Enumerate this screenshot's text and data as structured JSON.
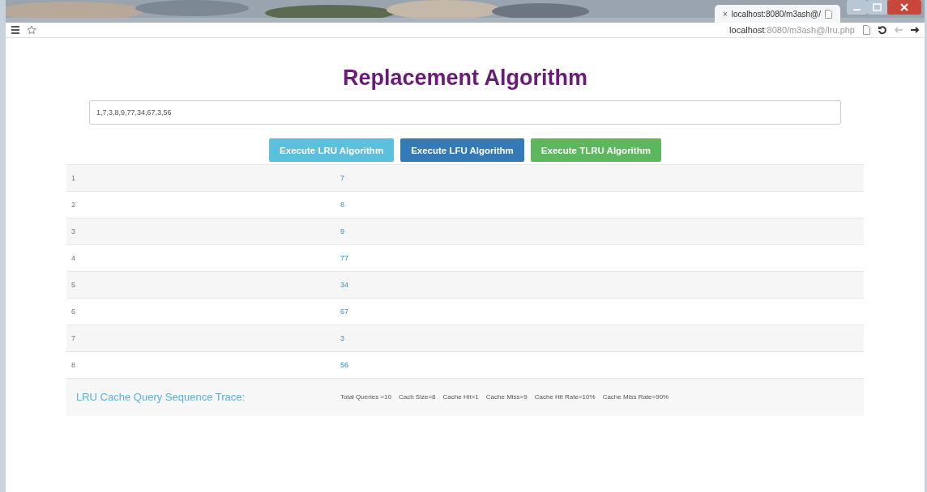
{
  "browser": {
    "tab_title": "localhost:8080/m3ash@/",
    "tab_close": "×",
    "url_host": "localhost",
    "url_path": ":8080/m3ash@/lru.php"
  },
  "page": {
    "title": "Replacement Algorithm",
    "input": {
      "value": "1,7,3,8,9,77,34,67,3,56"
    },
    "buttons": [
      {
        "label": "Execute LRU Algorithm",
        "color": "#5bc0de"
      },
      {
        "label": "Execute LFU Algorithm",
        "color": "#337ab7"
      },
      {
        "label": "Execute TLRU Algorithm",
        "color": "#5cb85c"
      }
    ],
    "rows": [
      {
        "index": "1",
        "value": "7"
      },
      {
        "index": "2",
        "value": "8"
      },
      {
        "index": "3",
        "value": "9"
      },
      {
        "index": "4",
        "value": "77"
      },
      {
        "index": "5",
        "value": "34"
      },
      {
        "index": "6",
        "value": "67"
      },
      {
        "index": "7",
        "value": "3"
      },
      {
        "index": "8",
        "value": "56"
      }
    ],
    "trace": {
      "label": "LRU Cache Query Sequence Trace:",
      "stats": [
        "Total Queries =10",
        "Cach Size=8",
        "Cache Hit=1",
        "Cache Miss=9",
        "Cache Hit Rate=10%",
        "Cache Miss Rate=90%"
      ]
    }
  }
}
